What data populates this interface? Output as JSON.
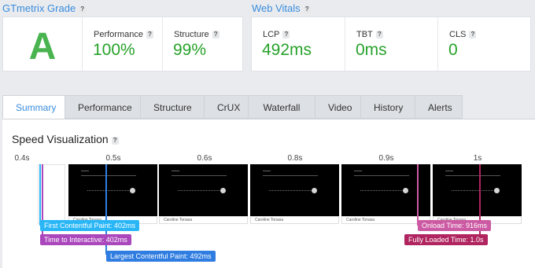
{
  "grade": {
    "title": "GTmetrix Grade",
    "help": "?",
    "letter": "A",
    "performance": {
      "label": "Performance",
      "value": "100%"
    },
    "structure": {
      "label": "Structure",
      "value": "99%"
    }
  },
  "vitals": {
    "title": "Web Vitals",
    "help": "?",
    "lcp": {
      "label": "LCP",
      "value": "492ms"
    },
    "tbt": {
      "label": "TBT",
      "value": "0ms"
    },
    "cls": {
      "label": "CLS",
      "value": "0"
    }
  },
  "tabs": [
    "Summary",
    "Performance",
    "Structure",
    "CrUX",
    "Waterfall",
    "Video",
    "History",
    "Alerts"
  ],
  "active_tab": "Summary",
  "speed": {
    "title": "Speed Visualization",
    "help": "?",
    "timeline": [
      "0.4s",
      "0.5s",
      "0.6s",
      "0.8s",
      "0.9s",
      "1s"
    ],
    "frame_caption": "Caroline Tonasa",
    "markers": {
      "fcp": {
        "label": "First Contentful Paint: 402ms",
        "color": "#29b6f6"
      },
      "tti": {
        "label": "Time to Interactive: 402ms",
        "color": "#ab47bc"
      },
      "lcp": {
        "label": "Largest Contentful Paint: 492ms",
        "color": "#2f7de1"
      },
      "onload": {
        "label": "Onload Time: 916ms",
        "color": "#cc5aa3"
      },
      "fully_loaded": {
        "label": "Fully Loaded Time: 1.0s",
        "color": "#b0245f"
      }
    }
  }
}
